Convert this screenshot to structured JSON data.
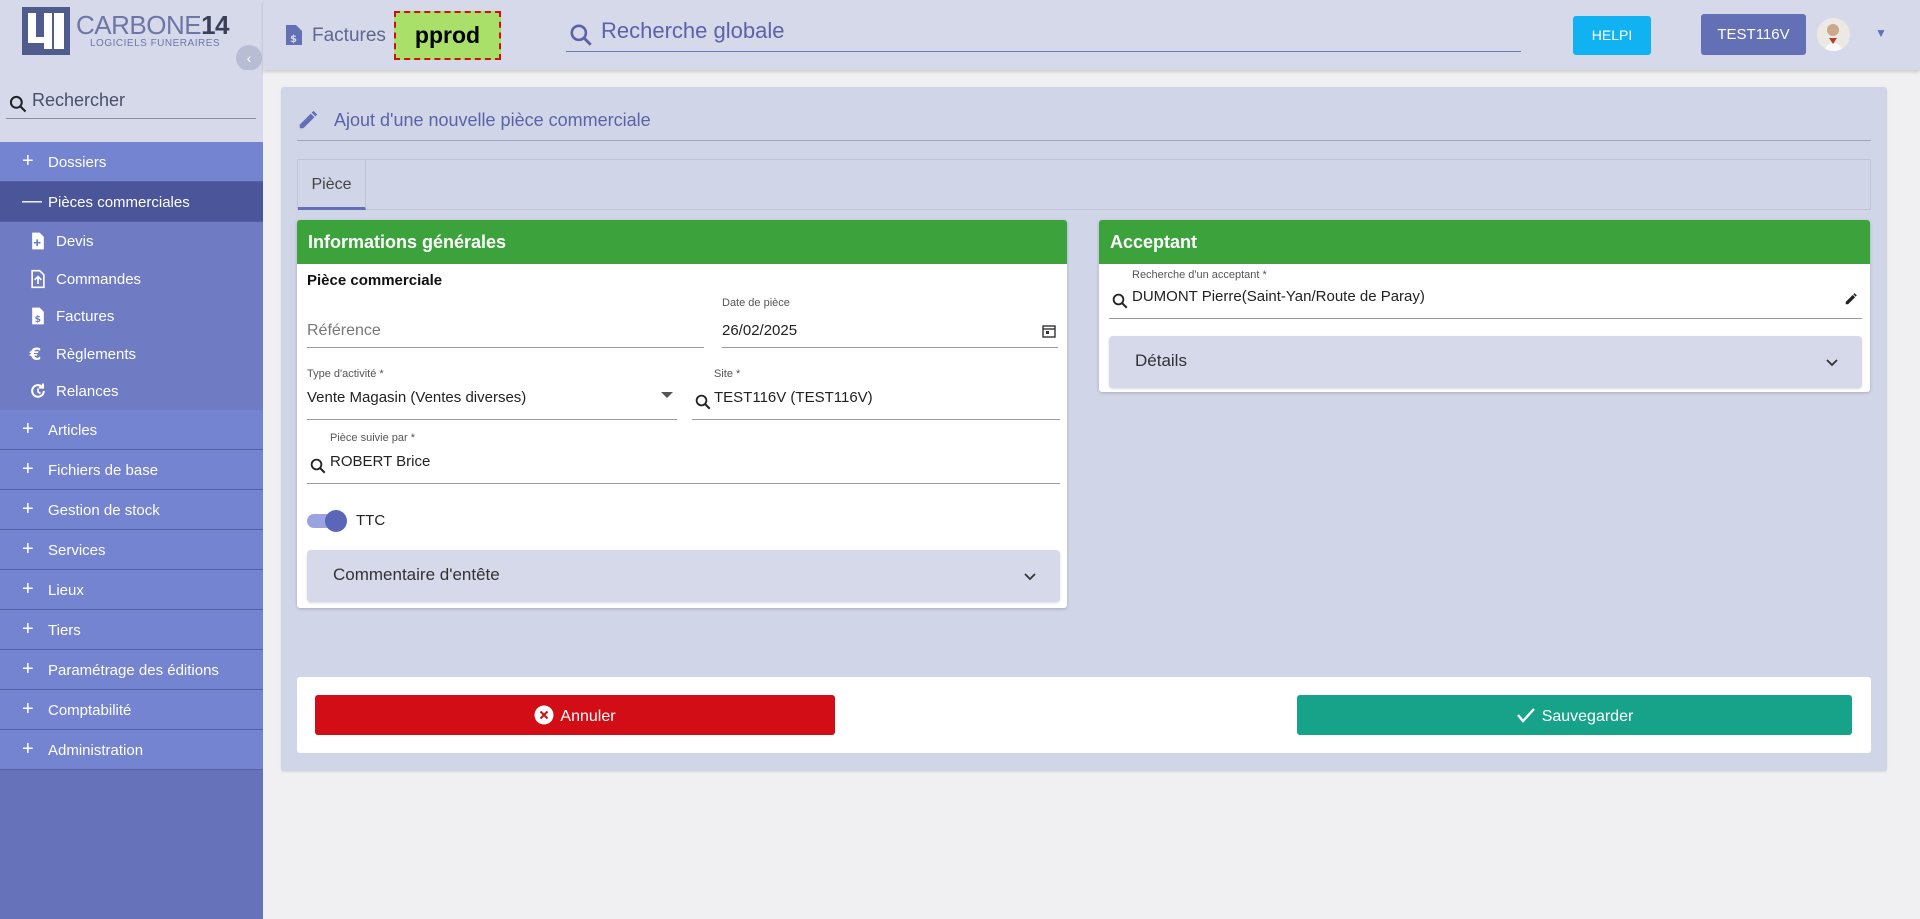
{
  "brand": {
    "name_light": "CARBONE",
    "name_bold": "14",
    "subtitle": "LOGICIELS FUNERAIRES"
  },
  "sidebar": {
    "search_placeholder": "Rechercher",
    "items": [
      {
        "label": "Dossiers",
        "expanded": false
      },
      {
        "label": "Pièces commerciales",
        "expanded": true,
        "children": [
          {
            "label": "Devis",
            "icon": "file-plus-icon"
          },
          {
            "label": "Commandes",
            "icon": "file-upload-icon"
          },
          {
            "label": "Factures",
            "icon": "file-dollar-icon"
          },
          {
            "label": "Règlements",
            "icon": "euro-icon"
          },
          {
            "label": "Relances",
            "icon": "reload-icon"
          }
        ]
      },
      {
        "label": "Articles",
        "expanded": false
      },
      {
        "label": "Fichiers de base",
        "expanded": false
      },
      {
        "label": "Gestion de stock",
        "expanded": false
      },
      {
        "label": "Services",
        "expanded": false
      },
      {
        "label": "Lieux",
        "expanded": false
      },
      {
        "label": "Tiers",
        "expanded": false
      },
      {
        "label": "Paramétrage des éditions",
        "expanded": false
      },
      {
        "label": "Comptabilité",
        "expanded": false
      },
      {
        "label": "Administration",
        "expanded": false
      }
    ]
  },
  "topbar": {
    "breadcrumb": "Factures",
    "env_badge": "pprod",
    "global_search_placeholder": "Recherche globale",
    "help_label": "HELPI",
    "user_label": "TEST116V"
  },
  "page": {
    "title": "Ajout d'une nouvelle pièce commerciale",
    "tabs": [
      {
        "label": "Pièce",
        "active": true
      }
    ]
  },
  "info_card": {
    "title": "Informations générales",
    "section": "Pièce commerciale",
    "reference_placeholder": "Référence",
    "date_label": "Date de pièce",
    "date_value": "26/02/2025",
    "activity_label": "Type d'activité *",
    "activity_value": "Vente Magasin (Ventes diverses)",
    "site_label": "Site *",
    "site_value": "TEST116V (TEST116V)",
    "followed_label": "Pièce suivie par *",
    "followed_value": "ROBERT Brice",
    "ttc_label": "TTC",
    "ttc_on": true,
    "comment_title": "Commentaire d'entête"
  },
  "acceptant_card": {
    "title": "Acceptant",
    "search_label": "Recherche d'un acceptant *",
    "search_value": "DUMONT Pierre(Saint-Yan/Route de Paray)",
    "details_title": "Détails"
  },
  "actions": {
    "cancel_label": "Annuler",
    "save_label": "Sauvegarder"
  },
  "colors": {
    "sidebar": "#6673ba",
    "card_header": "#3ca33c",
    "cancel": "#d30d16",
    "save": "#17a38a",
    "help": "#11b2f2"
  }
}
